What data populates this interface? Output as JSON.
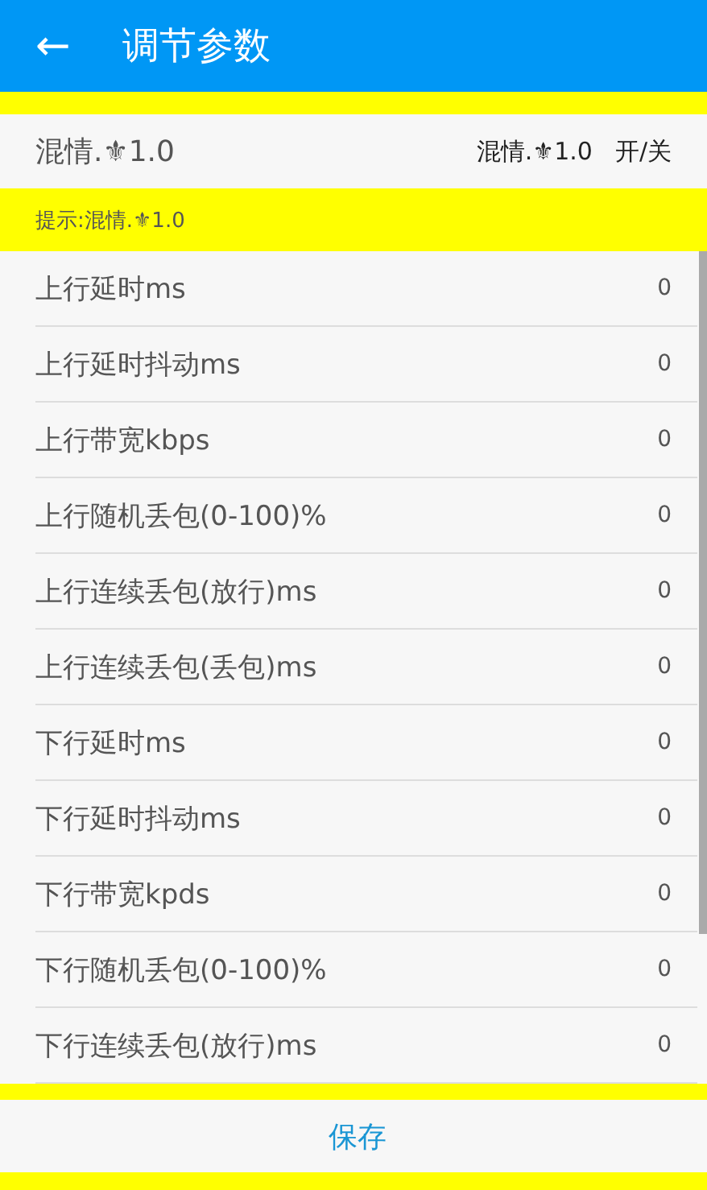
{
  "app_bar": {
    "back": "←",
    "title": "调节参数"
  },
  "mode_row": {
    "name": "混情.⚜1.0",
    "value": "混情.⚜1.0",
    "toggle": "开/关"
  },
  "hint": "提示:混情.⚜1.0",
  "params": [
    {
      "label": "上行延时ms",
      "value": "0"
    },
    {
      "label": "上行延时抖动ms",
      "value": "0"
    },
    {
      "label": "上行带宽kbps",
      "value": "0"
    },
    {
      "label": "上行随机丢包(0-100)%",
      "value": "0"
    },
    {
      "label": "上行连续丢包(放行)ms",
      "value": "0"
    },
    {
      "label": "上行连续丢包(丢包)ms",
      "value": "0"
    },
    {
      "label": "下行延时ms",
      "value": "0"
    },
    {
      "label": "下行延时抖动ms",
      "value": "0"
    },
    {
      "label": "下行带宽kpds",
      "value": "0"
    },
    {
      "label": "下行随机丢包(0-100)%",
      "value": "0"
    },
    {
      "label": "下行连续丢包(放行)ms",
      "value": "0"
    }
  ],
  "save": "保存"
}
